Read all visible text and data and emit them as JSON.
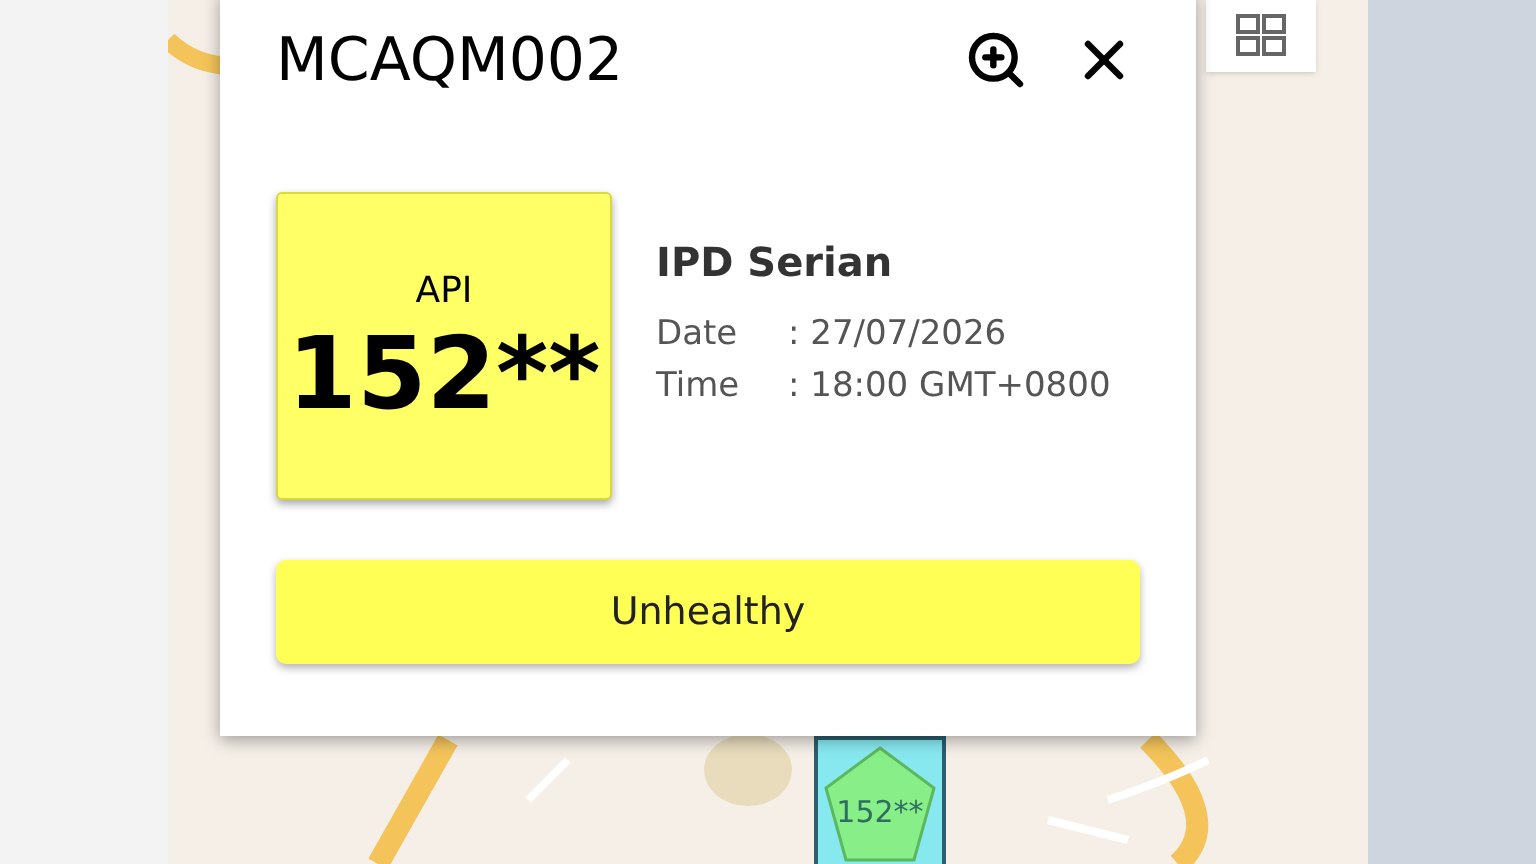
{
  "popup": {
    "title": "MCAQM002",
    "station": "IPD Serian",
    "api": {
      "label": "API",
      "value": "152**",
      "color": "#ffff66"
    },
    "details": [
      {
        "label": "Date",
        "value": ": 27/07/2026"
      },
      {
        "label": "Time",
        "value": ": 18:00 GMT+0800"
      }
    ],
    "status": {
      "label": "Unhealthy",
      "color": "#ffff55"
    }
  },
  "map": {
    "kind": "picture",
    "marker": {
      "label": "152**",
      "color": "#88ee88"
    }
  }
}
